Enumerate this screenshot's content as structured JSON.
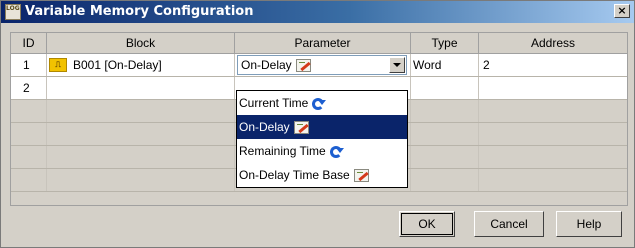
{
  "window": {
    "title": "Variable Memory Configuration",
    "close_label": "×"
  },
  "grid": {
    "columns": [
      "ID",
      "Block",
      "Parameter",
      "Type",
      "Address"
    ],
    "rows": [
      {
        "id": "1",
        "block": "B001 [On-Delay]",
        "parameter": "On-Delay",
        "type": "Word",
        "address": "2"
      },
      {
        "id": "2",
        "block": "",
        "parameter": "",
        "type": "",
        "address": ""
      }
    ]
  },
  "dropdown": {
    "options": [
      {
        "label": "Current Time",
        "icon": "refresh-icon",
        "selected": false
      },
      {
        "label": "On-Delay",
        "icon": "pencil-icon",
        "selected": true
      },
      {
        "label": "Remaining Time",
        "icon": "refresh-icon",
        "selected": false
      },
      {
        "label": "On-Delay Time Base",
        "icon": "pencil-icon",
        "selected": false
      }
    ]
  },
  "buttons": {
    "ok": "OK",
    "cancel": "Cancel",
    "help": "Help"
  },
  "colors": {
    "selection": "#0a246a",
    "titlebar": "#0a246a",
    "panel": "#d4d0c8"
  }
}
